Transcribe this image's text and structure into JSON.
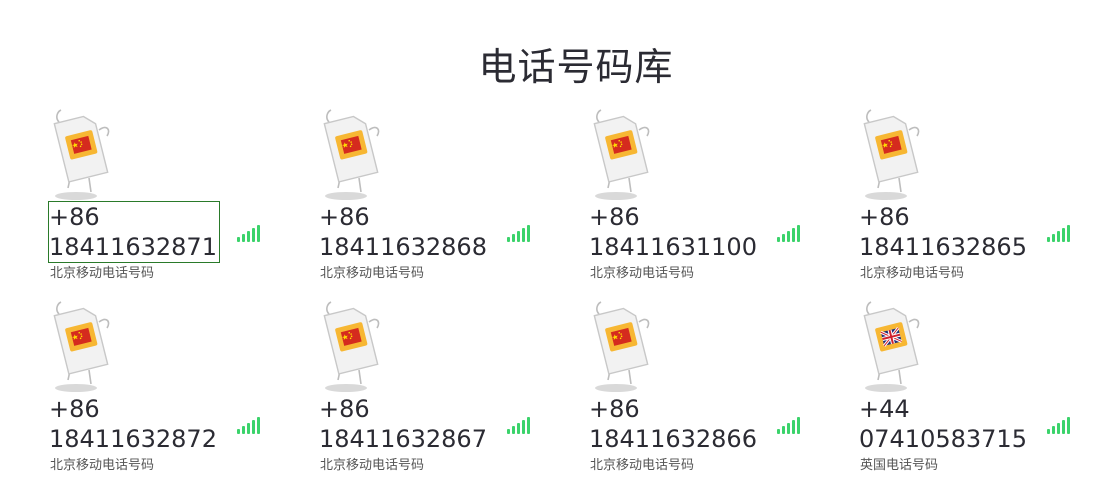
{
  "title": "电话号码库",
  "colors": {
    "signal": "#3bd36b",
    "sim_card": "#f2f2f2",
    "sim_outline": "#c8c8c8",
    "chip": "#f7b733",
    "china_flag": "#d52b1e",
    "star": "#ffde00"
  },
  "cards": [
    {
      "code": "+86",
      "number": "18411632871",
      "desc": "北京移动电话号码",
      "flag": "china-flag",
      "selected": true
    },
    {
      "code": "+86",
      "number": "18411632868",
      "desc": "北京移动电话号码",
      "flag": "china-flag"
    },
    {
      "code": "+86",
      "number": "18411631100",
      "desc": "北京移动电话号码",
      "flag": "china-flag"
    },
    {
      "code": "+86",
      "number": "18411632865",
      "desc": "北京移动电话号码",
      "flag": "china-flag"
    },
    {
      "code": "+86",
      "number": "18411632872",
      "desc": "北京移动电话号码",
      "flag": "china-flag"
    },
    {
      "code": "+86",
      "number": "18411632867",
      "desc": "北京移动电话号码",
      "flag": "china-flag"
    },
    {
      "code": "+86",
      "number": "18411632866",
      "desc": "北京移动电话号码",
      "flag": "china-flag"
    },
    {
      "code": "+44",
      "number": "07410583715",
      "desc": "英国电话号码",
      "flag": "uk-flag"
    }
  ]
}
